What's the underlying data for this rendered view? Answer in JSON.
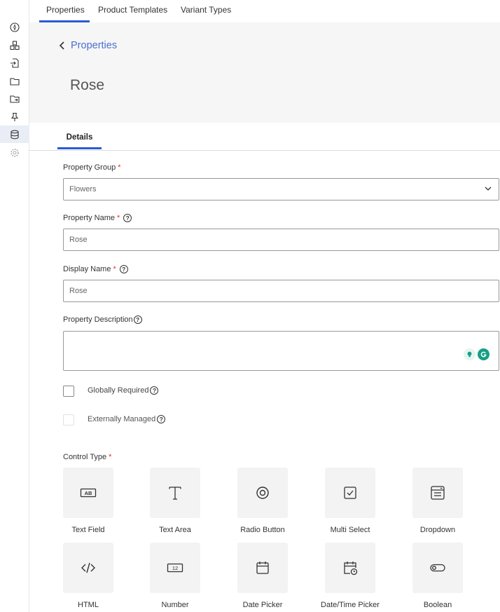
{
  "top_tabs": [
    "Properties",
    "Product Templates",
    "Variant Types"
  ],
  "breadcrumb_back": "Properties",
  "page_title": "Rose",
  "detail_tab": "Details",
  "form": {
    "property_group": {
      "label": "Property Group",
      "value": "Flowers"
    },
    "property_name": {
      "label": "Property Name",
      "value": "Rose"
    },
    "display_name": {
      "label": "Display Name",
      "value": "Rose"
    },
    "property_description": {
      "label": "Property Description",
      "value": ""
    },
    "globally_required": {
      "label": "Globally Required",
      "checked": false
    },
    "externally_managed": {
      "label": "Externally Managed",
      "checked": false,
      "disabled": true
    },
    "required_mark": "*",
    "help_mark": "?"
  },
  "control_type": {
    "label": "Control Type",
    "options": [
      {
        "label": "Text Field",
        "icon": "text-field-icon"
      },
      {
        "label": "Text Area",
        "icon": "text-area-icon"
      },
      {
        "label": "Radio Button",
        "icon": "radio-button-icon"
      },
      {
        "label": "Multi Select",
        "icon": "multi-select-icon"
      },
      {
        "label": "Dropdown",
        "icon": "dropdown-icon"
      },
      {
        "label": "HTML",
        "icon": "html-icon"
      },
      {
        "label": "Number",
        "icon": "number-icon"
      },
      {
        "label": "Date Picker",
        "icon": "date-picker-icon"
      },
      {
        "label": "Date/Time Picker",
        "icon": "date-time-picker-icon"
      },
      {
        "label": "Boolean",
        "icon": "boolean-icon"
      }
    ],
    "text_field_icon_text": "AB",
    "number_icon_text": "12"
  },
  "sidebar_icons": [
    "compass-icon",
    "boxes-icon",
    "import-icon",
    "folder-icon",
    "folder-export-icon",
    "pin-icon",
    "database-icon",
    "settings-icon"
  ],
  "colors": {
    "accent": "#2a5bd7",
    "link": "#4a6fd1",
    "required": "#d33333",
    "grammarly": "#15a085"
  }
}
